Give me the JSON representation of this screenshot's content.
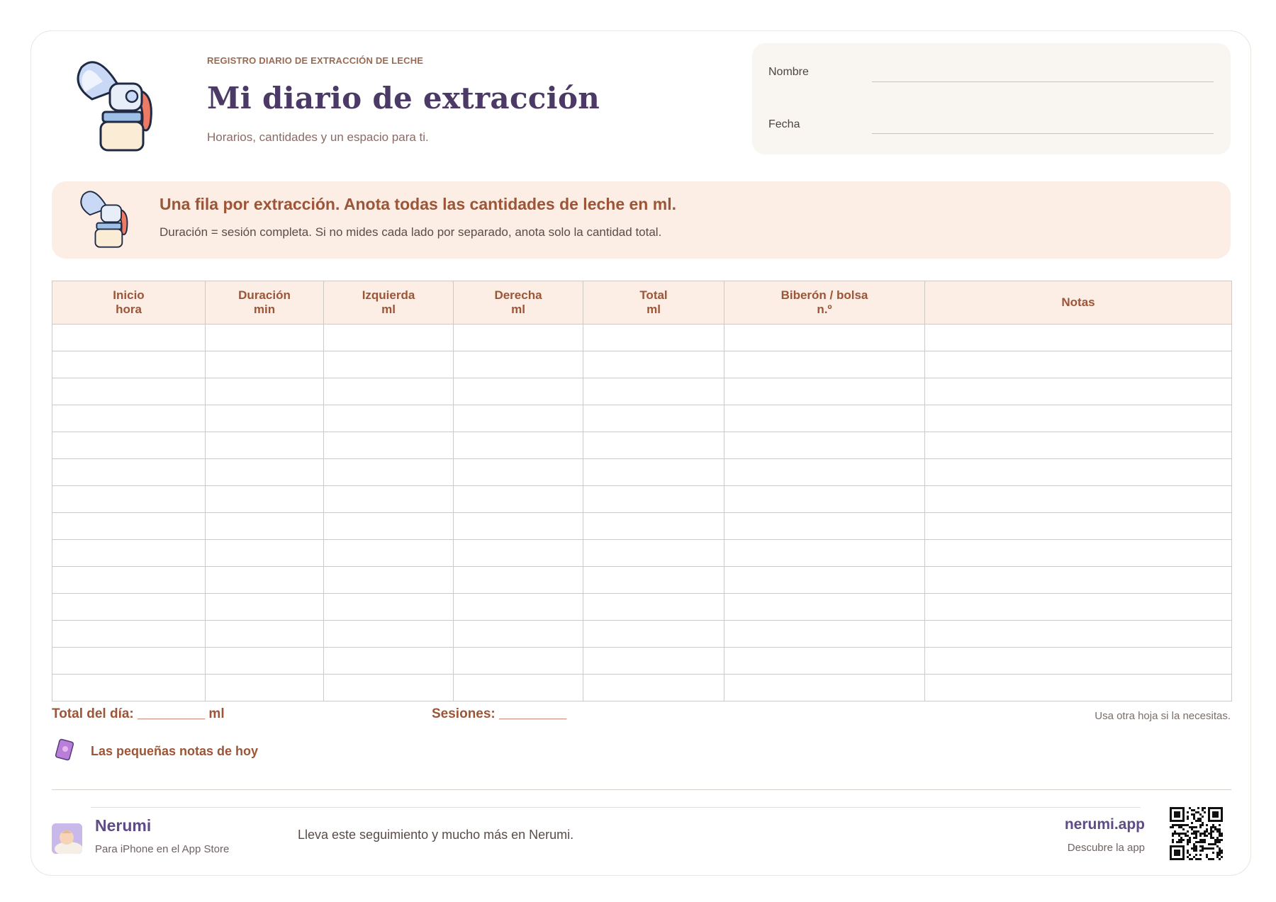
{
  "header": {
    "eyebrow": "REGISTRO DIARIO DE EXTRACCIÓN DE LECHE",
    "title": "Mi diario de extracción",
    "subtitle": "Horarios, cantidades y un espacio para ti."
  },
  "namebox": {
    "name_label": "Nombre",
    "date_label": "Fecha"
  },
  "banner": {
    "title": "Una fila por extracción. Anota todas las cantidades de leche en ml.",
    "text": "Duración = sesión completa. Si no mides cada lado por separado, anota solo la cantidad total."
  },
  "table": {
    "columns": [
      {
        "line1": "Inicio",
        "line2": "hora"
      },
      {
        "line1": "Duración",
        "line2": "min"
      },
      {
        "line1": "Izquierda",
        "line2": "ml"
      },
      {
        "line1": "Derecha",
        "line2": "ml"
      },
      {
        "line1": "Total",
        "line2": "ml"
      },
      {
        "line1": "Biberón / bolsa",
        "line2": "n.º"
      },
      {
        "line1": "Notas",
        "line2": ""
      }
    ],
    "empty_rows": 14
  },
  "totals": {
    "day_label": "Total del día: _________ ml",
    "sessions_label": "Sesiones: _________",
    "note": "Usa otra hoja si la necesitas."
  },
  "notes_section": {
    "title": "Las pequeñas notas de hoy",
    "icon": "notebook-icon"
  },
  "footer": {
    "brand": "Nerumi",
    "brand_sub": "Para iPhone en el App Store",
    "promo": "Lleva este seguimiento y mucho más en Nerumi.",
    "site": "nerumi.app",
    "site_sub": "Descubre la app"
  },
  "colors": {
    "accent": "#9c5536",
    "brand": "#5f4b86",
    "banner_bg": "#fcede5",
    "title": "#4b3a66"
  }
}
